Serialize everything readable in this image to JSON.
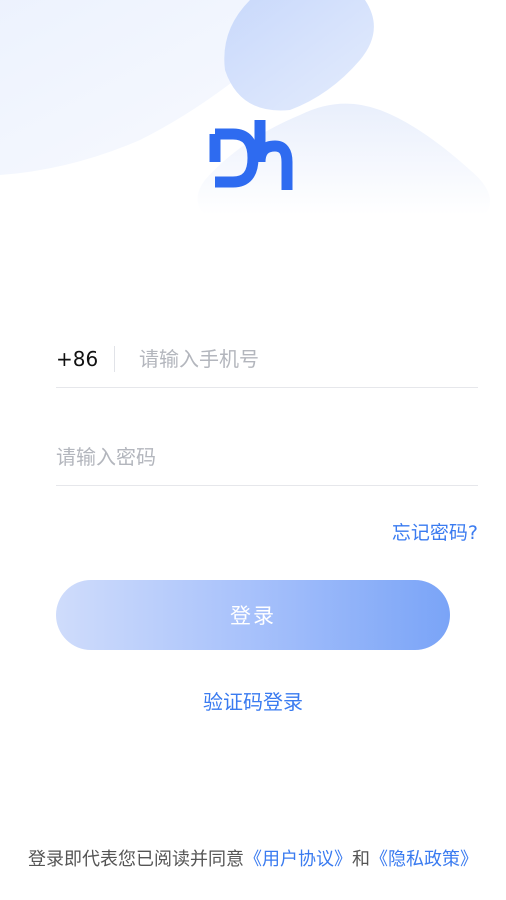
{
  "colors": {
    "accent": "#3a7bf0",
    "logo": "#2e6bf0",
    "button_gradient_start": "#cfdcfb",
    "button_gradient_end": "#7aa4f7",
    "placeholder": "#b3b6bd",
    "divider": "#e6e7eb"
  },
  "logo": {
    "icon": "dh-logo-icon"
  },
  "form": {
    "country_code": "+86",
    "phone_placeholder": "请输入手机号",
    "password_placeholder": "请输入密码",
    "forgot_password": "忘记密码?",
    "login_button": "登录",
    "sms_login": "验证码登录"
  },
  "agreement": {
    "prefix": "登录即代表您已阅读并同意",
    "user_agreement": "《用户协议》",
    "conjunction": "和",
    "privacy_policy": "《隐私政策》"
  }
}
